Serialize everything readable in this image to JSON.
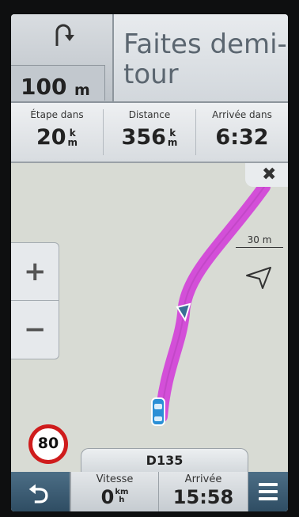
{
  "header": {
    "turn_distance_value": "100",
    "turn_distance_unit": "m",
    "instruction_line1": "Faites demi-",
    "instruction_line2": "tour"
  },
  "stats": [
    {
      "label": "Étape dans",
      "value": "20",
      "unit_top": "k",
      "unit_bottom": "m"
    },
    {
      "label": "Distance",
      "value": "356",
      "unit_top": "k",
      "unit_bottom": "m"
    },
    {
      "label": "Arrivée dans",
      "value": "6:32"
    }
  ],
  "map": {
    "close_label": "✖",
    "scale_label": "30 m",
    "zoom_in_label": "+",
    "zoom_out_label": "−",
    "speed_limit": "80",
    "route_color": "#d34fd8"
  },
  "bottom": {
    "road_name": "D135",
    "speed_label": "Vitesse",
    "speed_value": "0",
    "speed_unit_top": "km",
    "speed_unit_bottom": "h",
    "arrival_label": "Arrivée",
    "arrival_value": "15:58"
  },
  "colors": {
    "accent_blue": "#2f4d63",
    "speed_ring": "#cf1c1c"
  }
}
